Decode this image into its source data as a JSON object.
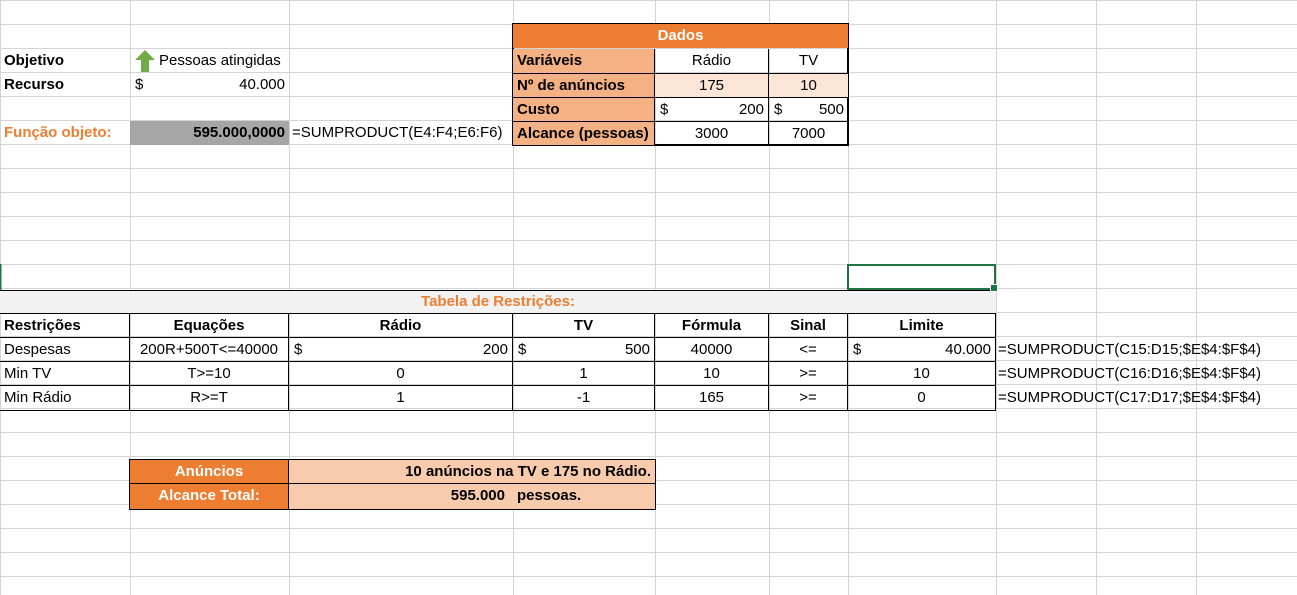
{
  "objective": {
    "label": "Objetivo",
    "value": "Pessoas atingidas",
    "icon": "green-up-arrow-icon"
  },
  "resource": {
    "label": "Recurso",
    "currency": "$",
    "value": "40.000"
  },
  "objective_function": {
    "label": "Função objeto:",
    "value": "595.000,0000",
    "formula": "=SUMPRODUCT(E4:F4;E6:F6)"
  },
  "data_table": {
    "title": "Dados",
    "headers": [
      "Variáveis",
      "Rádio",
      "TV"
    ],
    "rows": [
      {
        "label": "Nº de anúncios",
        "radio": "175",
        "tv": "10"
      },
      {
        "label": "Custo",
        "currency": "$",
        "radio": "200",
        "tv": "500"
      },
      {
        "label": "Alcance (pessoas)",
        "radio": "3000",
        "tv": "7000"
      }
    ]
  },
  "constraints": {
    "title": "Tabela de Restrições:",
    "headers": [
      "Restrições",
      "Equações",
      "Rádio",
      "TV",
      "Fórmula",
      "Sinal",
      "Limite"
    ],
    "currency": "$",
    "rows": [
      {
        "name": "Despesas",
        "equation": "200R+500T<=40000",
        "radio": "200",
        "tv": "500",
        "formula": "40000",
        "sign": "<=",
        "limit": "40.000",
        "excel": "=SUMPRODUCT(C15:D15;$E$4:$F$4)"
      },
      {
        "name": "Min TV",
        "equation": "T>=10",
        "radio": "0",
        "tv": "1",
        "formula": "10",
        "sign": ">=",
        "limit": "10",
        "excel": "=SUMPRODUCT(C16:D16;$E$4:$F$4)"
      },
      {
        "name": "Min Rádio",
        "equation": "R>=T",
        "radio": "1",
        "tv": "-1",
        "formula": "165",
        "sign": ">=",
        "limit": "0",
        "excel": "=SUMPRODUCT(C17:D17;$E$4:$F$4)"
      }
    ]
  },
  "summary": {
    "ads_label": "Anúncios",
    "ads_value": "10 anúncios na TV e 175 no Rádio.",
    "reach_label": "Alcance Total:",
    "reach_value": "595.000",
    "reach_unit": "pessoas."
  },
  "colors": {
    "accent": "#ed7d31",
    "peach": "#f8cbad",
    "gridline": "#d4d4d4",
    "selection": "#217346",
    "arrow": "#70ad47"
  }
}
